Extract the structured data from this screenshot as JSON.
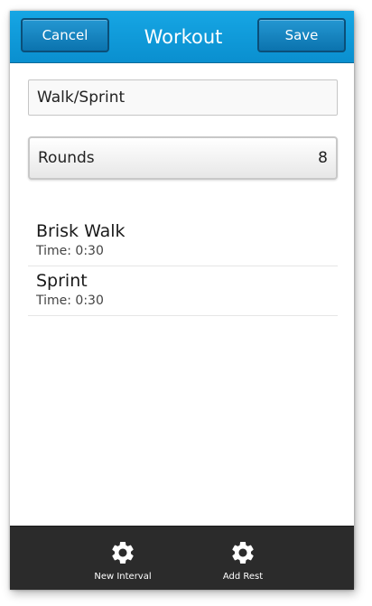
{
  "titlebar": {
    "cancel_label": "Cancel",
    "title": "Workout",
    "save_label": "Save"
  },
  "workout_name": "Walk/Sprint",
  "rounds": {
    "label": "Rounds",
    "value": "8"
  },
  "intervals": [
    {
      "title": "Brisk Walk",
      "subtitle": "Time: 0:30"
    },
    {
      "title": "Sprint",
      "subtitle": "Time: 0:30"
    }
  ],
  "actions": [
    {
      "label": "New Interval",
      "icon": "gear-icon"
    },
    {
      "label": "Add Rest",
      "icon": "gear-icon"
    }
  ],
  "colors": {
    "titlebar": "#0f9cdc",
    "button": "#0b73ae",
    "action_bar": "#2b2b2b"
  }
}
